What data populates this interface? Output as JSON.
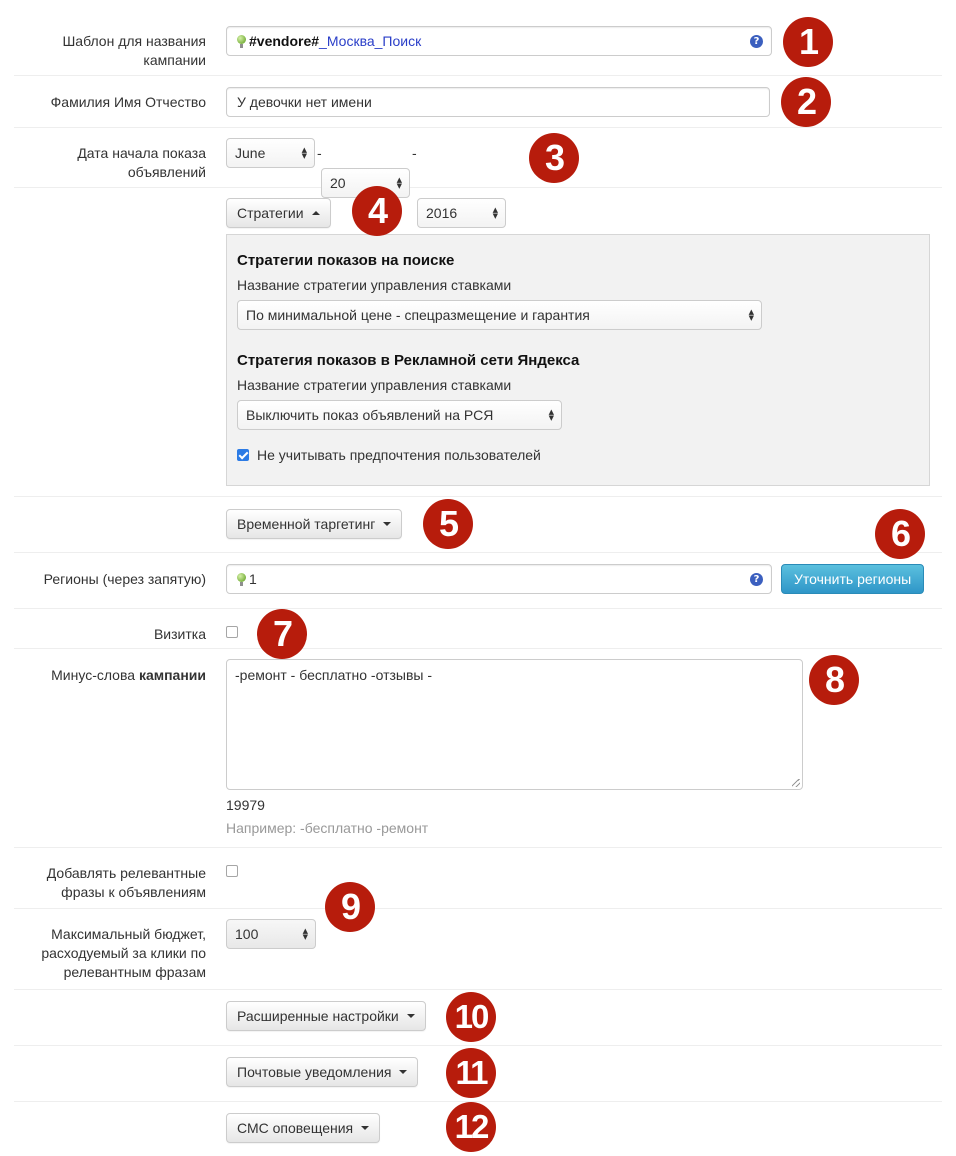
{
  "campaign_template": {
    "label": "Шаблон для названия кампании",
    "token": "#vendore#",
    "suffix": "_Москва_Поиск",
    "help": "?"
  },
  "full_name": {
    "label": "Фамилия Имя Отчество",
    "value": "У девочки нет имени"
  },
  "start_date": {
    "label": "Дата начала показа объявлений",
    "month": "June",
    "day": "20",
    "year": "2016",
    "separator": "-"
  },
  "strategies": {
    "toggle_label": "Стратегии",
    "search": {
      "heading": "Стратегии показов на поиске",
      "label": "Название стратегии управления ставками",
      "value": "По минимальной цене - спецразмещение и гарантия"
    },
    "network": {
      "heading": "Стратегия показов в Рекламной сети Яндекса",
      "label": "Название стратегии управления ставками",
      "value": "Выключить показ объявлений на РСЯ"
    },
    "ignore_prefs": {
      "label": "Не учитывать предпочтения пользователей",
      "checked": true
    }
  },
  "time_targeting": {
    "label": "Временной таргетинг"
  },
  "regions": {
    "label": "Регионы (через запятую)",
    "value": "1",
    "help": "?",
    "refine_button": "Уточнить регионы"
  },
  "vcard": {
    "label": "Визитка",
    "checked": false
  },
  "minus_words": {
    "label_prefix": "Минус-слова ",
    "label_bold": "кампании",
    "value": "-ремонт - бесплатно -отзывы -",
    "count": "19979",
    "hint": "Например: -бесплатно -ремонт"
  },
  "relevant_phrases": {
    "label": "Добавлять релевантные фразы к объявлениям",
    "checked": false
  },
  "max_budget": {
    "label": "Максимальный бюджет, расходуемый за клики по релевантным фразам",
    "value": "100"
  },
  "advanced_settings": {
    "label": "Расширенные настройки"
  },
  "email_notifications": {
    "label": "Почтовые уведомления"
  },
  "sms_notifications": {
    "label": "СМС оповещения"
  },
  "badges": [
    "1",
    "2",
    "3",
    "4",
    "5",
    "6",
    "7",
    "8",
    "9",
    "10",
    "11",
    "12"
  ],
  "colors": {
    "badge": "#b71c0c",
    "info_button": "#5bc0de",
    "checkbox_checked": "#2c7be5",
    "template_link": "#2a3ec8"
  },
  "icons": [
    "bulb-icon",
    "help-icon",
    "select-arrows-icon",
    "caret-down-icon",
    "caret-up-icon",
    "resize-grip-icon"
  ]
}
